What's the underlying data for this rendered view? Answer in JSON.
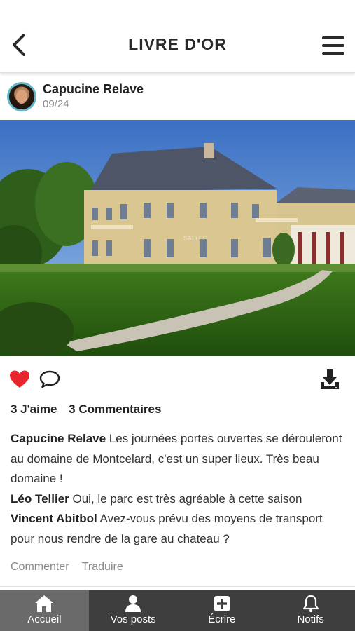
{
  "header": {
    "title": "LIVRE D'OR"
  },
  "post": {
    "author": "Capucine Relave",
    "date": "09/24",
    "photo_watermark": "SALLES",
    "likes_label": "3 J'aime",
    "comments_label": "3 Commentaires",
    "comments": [
      {
        "author": "Capucine Relave",
        "text": "Les journées portes ouvertes se dérouleront au domaine de Montcelard, c'est un super lieux. Très beau domaine !"
      },
      {
        "author": "Léo Tellier",
        "text": "Oui, le parc est très agréable à cette saison"
      },
      {
        "author": "Vincent Abitbol",
        "text": "Avez-vous prévu des moyens de transport pour nous rendre de la gare au chateau ?"
      }
    ],
    "comment_link": "Commenter",
    "translate_link": "Traduire"
  },
  "colors": {
    "like": "#e8242c",
    "tabbar": "#3e3e3e",
    "tab_active": "#6a6a6a",
    "avatar_ring": "#62b7c9"
  },
  "icons": {
    "back": "chevron-left-icon",
    "menu": "hamburger-icon",
    "like": "heart-icon",
    "comment": "speech-bubble-icon",
    "download": "download-icon",
    "home": "home-icon",
    "posts": "user-icon",
    "write": "plus-square-icon",
    "notifs": "bell-icon"
  },
  "tabbar": {
    "tabs": [
      {
        "label": "Accueil",
        "active": true
      },
      {
        "label": "Vos posts",
        "active": false
      },
      {
        "label": "Écrire",
        "active": false
      },
      {
        "label": "Notifs",
        "active": false
      }
    ]
  }
}
